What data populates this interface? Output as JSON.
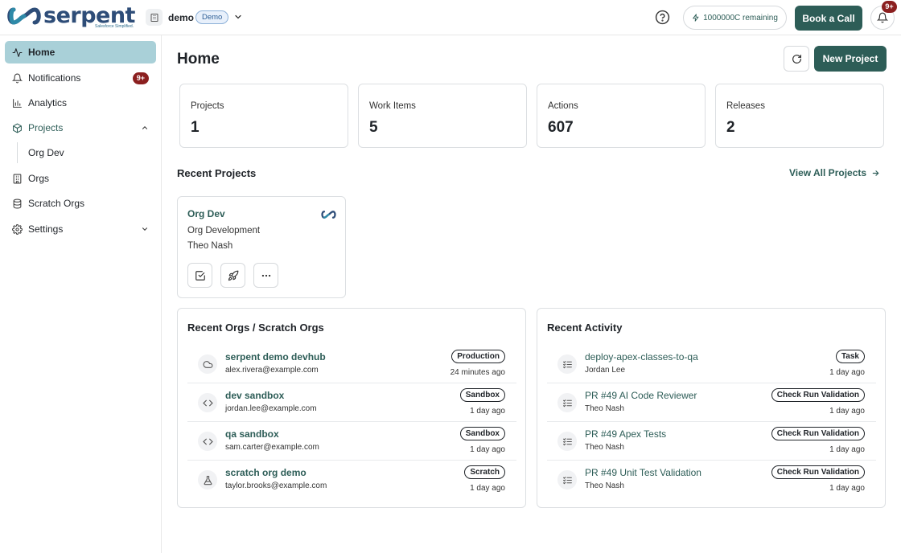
{
  "brand": {
    "name": "serpent",
    "tagline": "Salesforce Simplified."
  },
  "workspace": {
    "name": "demo",
    "badge": "Demo"
  },
  "header": {
    "credits": "1000000C remaining",
    "book_call": "Book a Call",
    "notifications_badge": "9+"
  },
  "sidebar": {
    "items": [
      {
        "label": "Home",
        "icon": "activity-icon"
      },
      {
        "label": "Notifications",
        "icon": "bell-icon",
        "badge": "9+"
      },
      {
        "label": "Analytics",
        "icon": "bar-chart-icon"
      },
      {
        "label": "Projects",
        "icon": "package-icon"
      },
      {
        "label": "Orgs",
        "icon": "building-icon"
      },
      {
        "label": "Scratch Orgs",
        "icon": "database-icon"
      },
      {
        "label": "Settings",
        "icon": "gear-icon"
      }
    ],
    "sub_items": [
      "Org Dev"
    ]
  },
  "main": {
    "title": "Home",
    "new_project": "New Project",
    "stats": [
      {
        "label": "Projects",
        "value": "1"
      },
      {
        "label": "Work Items",
        "value": "5"
      },
      {
        "label": "Actions",
        "value": "607"
      },
      {
        "label": "Releases",
        "value": "2"
      }
    ],
    "recent_projects": {
      "title": "Recent Projects",
      "view_all": "View All Projects",
      "card": {
        "name": "Org Dev",
        "type": "Org Development",
        "owner": "Theo Nash"
      }
    },
    "recent_orgs": {
      "title": "Recent Orgs / Scratch Orgs",
      "rows": [
        {
          "name": "serpent demo devhub",
          "email": "alex.rivera@example.com",
          "tag": "Production",
          "time": "24 minutes ago",
          "icon": "cloud-icon"
        },
        {
          "name": "dev sandbox",
          "email": "jordan.lee@example.com",
          "tag": "Sandbox",
          "time": "1 day ago",
          "icon": "code-icon"
        },
        {
          "name": "qa sandbox",
          "email": "sam.carter@example.com",
          "tag": "Sandbox",
          "time": "1 day ago",
          "icon": "code-icon"
        },
        {
          "name": "scratch org demo",
          "email": "taylor.brooks@example.com",
          "tag": "Scratch",
          "time": "1 day ago",
          "icon": "flask-icon"
        }
      ]
    },
    "recent_activity": {
      "title": "Recent Activity",
      "rows": [
        {
          "name": "deploy-apex-classes-to-qa",
          "user": "Jordan Lee",
          "tag": "Task",
          "time": "1 day ago"
        },
        {
          "name": "PR #49 AI Code Reviewer",
          "user": "Theo Nash",
          "tag": "Check Run Validation",
          "time": "1 day ago"
        },
        {
          "name": "PR #49 Apex Tests",
          "user": "Theo Nash",
          "tag": "Check Run Validation",
          "time": "1 day ago"
        },
        {
          "name": "PR #49 Unit Test Validation",
          "user": "Theo Nash",
          "tag": "Check Run Validation",
          "time": "1 day ago"
        }
      ]
    }
  },
  "colors": {
    "accent": "#2d5d57",
    "active_nav": "#a9d0d8",
    "badge": "#8b1f1f",
    "logo": "#2e4d78"
  }
}
